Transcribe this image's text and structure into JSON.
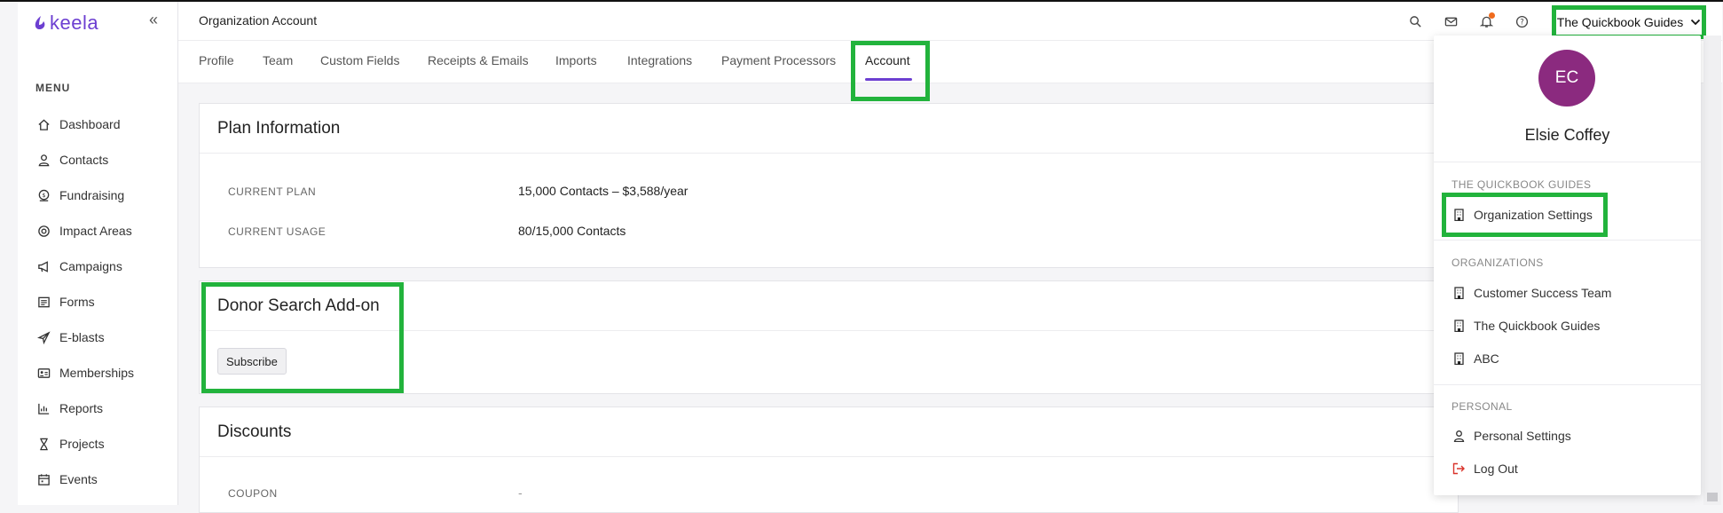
{
  "app": {
    "logo_text": "keela",
    "collapse_icon": "«",
    "brand_color": "#6c3fd1"
  },
  "sidebar": {
    "menu_title": "MENU",
    "items": [
      {
        "label": "Dashboard",
        "icon": "home-icon"
      },
      {
        "label": "Contacts",
        "icon": "user-icon"
      },
      {
        "label": "Fundraising",
        "icon": "fundraising-icon"
      },
      {
        "label": "Impact Areas",
        "icon": "impact-icon"
      },
      {
        "label": "Campaigns",
        "icon": "megaphone-icon"
      },
      {
        "label": "Forms",
        "icon": "form-icon"
      },
      {
        "label": "E-blasts",
        "icon": "send-icon"
      },
      {
        "label": "Memberships",
        "icon": "membership-icon"
      },
      {
        "label": "Reports",
        "icon": "chart-icon"
      },
      {
        "label": "Projects",
        "icon": "hourglass-icon"
      },
      {
        "label": "Events",
        "icon": "calendar-icon"
      }
    ]
  },
  "header": {
    "title": "Organization Account",
    "org_button": "The Quickbook Guides"
  },
  "tabs": [
    {
      "label": "Profile"
    },
    {
      "label": "Team"
    },
    {
      "label": "Custom Fields"
    },
    {
      "label": "Receipts & Emails"
    },
    {
      "label": "Imports"
    },
    {
      "label": "Integrations"
    },
    {
      "label": "Payment Processors"
    },
    {
      "label": "Account"
    }
  ],
  "plan": {
    "title": "Plan Information",
    "current_plan_label": "CURRENT PLAN",
    "current_plan_value": "15,000 Contacts – $3,588/year",
    "current_usage_label": "CURRENT USAGE",
    "current_usage_value": "80/15,000 Contacts"
  },
  "donor_search": {
    "title": "Donor Search Add-on",
    "subscribe_label": "Subscribe"
  },
  "discounts": {
    "title": "Discounts",
    "coupon_label": "COUPON",
    "coupon_value": "-"
  },
  "dropdown": {
    "avatar_initials": "EC",
    "user_name": "Elsie Coffey",
    "current_org_section": "THE QUICKBOOK GUIDES",
    "org_settings": "Organization Settings",
    "organizations_section": "ORGANIZATIONS",
    "organizations": [
      "Customer Success Team",
      "The Quickbook Guides",
      "ABC"
    ],
    "personal_section": "PERSONAL",
    "personal_settings": "Personal Settings",
    "logout": "Log Out"
  },
  "colors": {
    "highlight": "#22b33c",
    "avatar": "#8b2a7f",
    "logout_icon": "#d9342b",
    "notification": "#ef6b1d"
  }
}
